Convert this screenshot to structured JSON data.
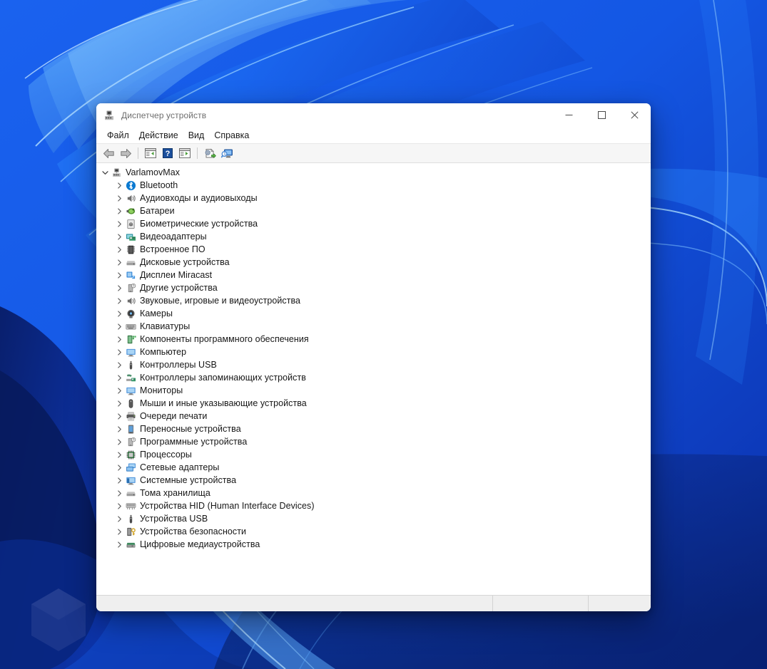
{
  "desktop": {
    "wallpaper_name": "windows-11-bloom-wallpaper",
    "colors": {
      "deep_blue": "#0b2f9e",
      "mid_blue": "#1763e8",
      "bright_blue": "#2d8bf7",
      "light_blue": "#6fc0ff",
      "dark_navy": "#071b63"
    },
    "hexagon_badge": {
      "name": "hexagon-watermark",
      "color": "#44569c"
    }
  },
  "window": {
    "title": "Диспетчер устройств",
    "title_icon": "device-manager-icon",
    "controls": {
      "minimize": "—",
      "maximize": "▢",
      "close": "✕",
      "minimize_name": "minimize-button",
      "maximize_name": "maximize-button",
      "close_name": "close-button"
    },
    "menubar": [
      {
        "label": "Файл",
        "name": "menu-file"
      },
      {
        "label": "Действие",
        "name": "menu-action"
      },
      {
        "label": "Вид",
        "name": "menu-view"
      },
      {
        "label": "Справка",
        "name": "menu-help"
      }
    ],
    "toolbar": [
      {
        "name": "back-button",
        "icon": "back-arrow-icon",
        "tooltip": "Назад"
      },
      {
        "name": "forward-button",
        "icon": "forward-arrow-icon",
        "tooltip": "Вперёд"
      },
      {
        "name": "toolbar-separator-1",
        "icon": "separator"
      },
      {
        "name": "properties-button",
        "icon": "properties-icon",
        "tooltip": "Свойства"
      },
      {
        "name": "help-button",
        "icon": "help-question-icon",
        "tooltip": "Справка"
      },
      {
        "name": "show-hide-console-tree-button",
        "icon": "console-tree-icon",
        "tooltip": "Показать или скрыть дерево консоли"
      },
      {
        "name": "toolbar-separator-2",
        "icon": "separator"
      },
      {
        "name": "update-driver-button",
        "icon": "update-driver-icon",
        "tooltip": "Обновить драйвер"
      },
      {
        "name": "scan-hardware-changes-button",
        "icon": "scan-hardware-icon",
        "tooltip": "Обновить конфигурацию оборудования"
      }
    ],
    "statusbar": {
      "main": "",
      "middle": "",
      "end": ""
    }
  },
  "tree": {
    "root": {
      "label": "VarlamovMax",
      "icon": "computer-root-icon",
      "expanded": true,
      "chevron": "expanded"
    },
    "items": [
      {
        "label": "Bluetooth",
        "icon": "bluetooth-icon",
        "chevron": "collapsed"
      },
      {
        "label": "Аудиовходы и аудиовыходы",
        "icon": "audio-io-icon",
        "chevron": "collapsed"
      },
      {
        "label": "Батареи",
        "icon": "battery-icon",
        "chevron": "collapsed"
      },
      {
        "label": "Биометрические устройства",
        "icon": "fingerprint-icon",
        "chevron": "collapsed"
      },
      {
        "label": "Видеоадаптеры",
        "icon": "display-adapter-icon",
        "chevron": "collapsed"
      },
      {
        "label": "Встроенное ПО",
        "icon": "firmware-chip-icon",
        "chevron": "collapsed"
      },
      {
        "label": "Дисковые устройства",
        "icon": "disk-drive-icon",
        "chevron": "collapsed"
      },
      {
        "label": "Дисплеи Miracast",
        "icon": "miracast-display-icon",
        "chevron": "collapsed"
      },
      {
        "label": "Другие устройства",
        "icon": "other-devices-icon",
        "chevron": "collapsed"
      },
      {
        "label": "Звуковые, игровые и видеоустройства",
        "icon": "sound-video-game-icon",
        "chevron": "collapsed"
      },
      {
        "label": "Камеры",
        "icon": "camera-icon",
        "chevron": "collapsed"
      },
      {
        "label": "Клавиатуры",
        "icon": "keyboard-icon",
        "chevron": "collapsed"
      },
      {
        "label": "Компоненты программного обеспечения",
        "icon": "software-component-icon",
        "chevron": "collapsed"
      },
      {
        "label": "Компьютер",
        "icon": "computer-icon",
        "chevron": "collapsed"
      },
      {
        "label": "Контроллеры USB",
        "icon": "usb-controller-icon",
        "chevron": "collapsed"
      },
      {
        "label": "Контроллеры запоминающих устройств",
        "icon": "storage-controller-icon",
        "chevron": "collapsed"
      },
      {
        "label": "Мониторы",
        "icon": "monitor-icon",
        "chevron": "collapsed"
      },
      {
        "label": "Мыши и иные указывающие устройства",
        "icon": "mouse-icon",
        "chevron": "collapsed"
      },
      {
        "label": "Очереди печати",
        "icon": "print-queue-icon",
        "chevron": "collapsed"
      },
      {
        "label": "Переносные устройства",
        "icon": "portable-device-icon",
        "chevron": "collapsed"
      },
      {
        "label": "Программные устройства",
        "icon": "software-device-icon",
        "chevron": "collapsed"
      },
      {
        "label": "Процессоры",
        "icon": "processor-icon",
        "chevron": "collapsed"
      },
      {
        "label": "Сетевые адаптеры",
        "icon": "network-adapter-icon",
        "chevron": "collapsed"
      },
      {
        "label": "Системные устройства",
        "icon": "system-device-icon",
        "chevron": "collapsed"
      },
      {
        "label": "Тома хранилища",
        "icon": "storage-volume-icon",
        "chevron": "collapsed"
      },
      {
        "label": "Устройства HID (Human Interface Devices)",
        "icon": "hid-device-icon",
        "chevron": "collapsed"
      },
      {
        "label": "Устройства USB",
        "icon": "usb-device-icon",
        "chevron": "collapsed"
      },
      {
        "label": "Устройства безопасности",
        "icon": "security-device-icon",
        "chevron": "collapsed"
      },
      {
        "label": "Цифровые медиаустройства",
        "icon": "digital-media-icon",
        "chevron": "collapsed"
      }
    ]
  }
}
